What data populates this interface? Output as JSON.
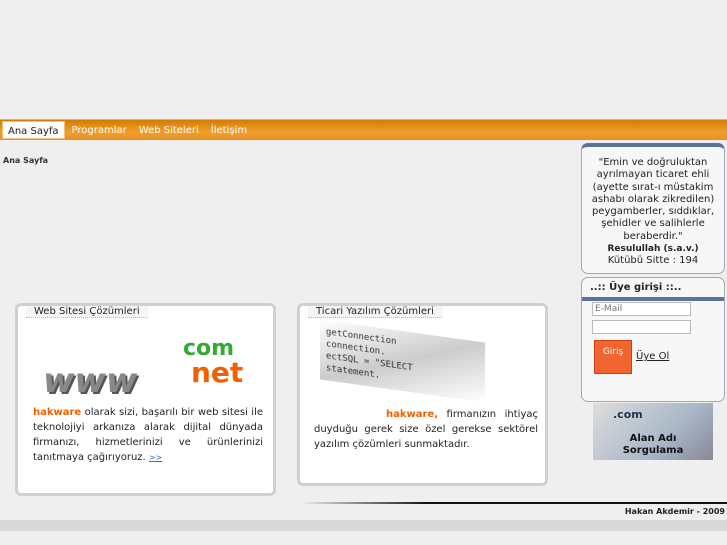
{
  "nav": {
    "items": [
      {
        "label": "Ana Sayfa"
      },
      {
        "label": "Programlar"
      },
      {
        "label": "Web Siteleri"
      },
      {
        "label": "İletişim"
      }
    ]
  },
  "breadcrumb": "Ana Sayfa",
  "web_box": {
    "title": "Web Sitesi Çözümleri",
    "brand": "hakware",
    "text": " olarak sizi, başarılı bir web sitesi ile teknolojiyi arkanıza alarak dijital dünyada firmanızı, hizmetlerinizi ve ürünlerinizi tanıtmaya çağırıyoruz.",
    "more": ">>",
    "logo_www": "www",
    "logo_com": "com",
    "logo_net": "net"
  },
  "soft_box": {
    "title": "Ticari Yazılım Çözümleri",
    "brand": "hakware,",
    "text": " firmanızın ihtiyaç duyduğu gerek size özel gerekse sektörel yazılım çözümleri sunmaktadır.",
    "code": [
      "getConnection",
      "connection.",
      "ectSQL = \"SELECT",
      "statement."
    ]
  },
  "quote": {
    "text": "\"Emin ve doğruluktan ayrılmayan ticaret ehli (ayette sırat-ı müstakim ashabı olarak zikredilen) peygamberler, sıddıklar, şehidler ve salihlerle beraberdir.\"",
    "author": "Resulullah (s.a.v.)",
    "source": "Kütübü Sitte : 194"
  },
  "login": {
    "title": "..:: Üye girişi ::..",
    "email_placeholder": "E-Mail",
    "button": "Giriş",
    "register": "Üye Ol"
  },
  "banner": {
    "line1": "Alan Adı",
    "line2": "Sorgulama",
    "com": ".com"
  },
  "footer": "Hakan Akdemir - 2009"
}
